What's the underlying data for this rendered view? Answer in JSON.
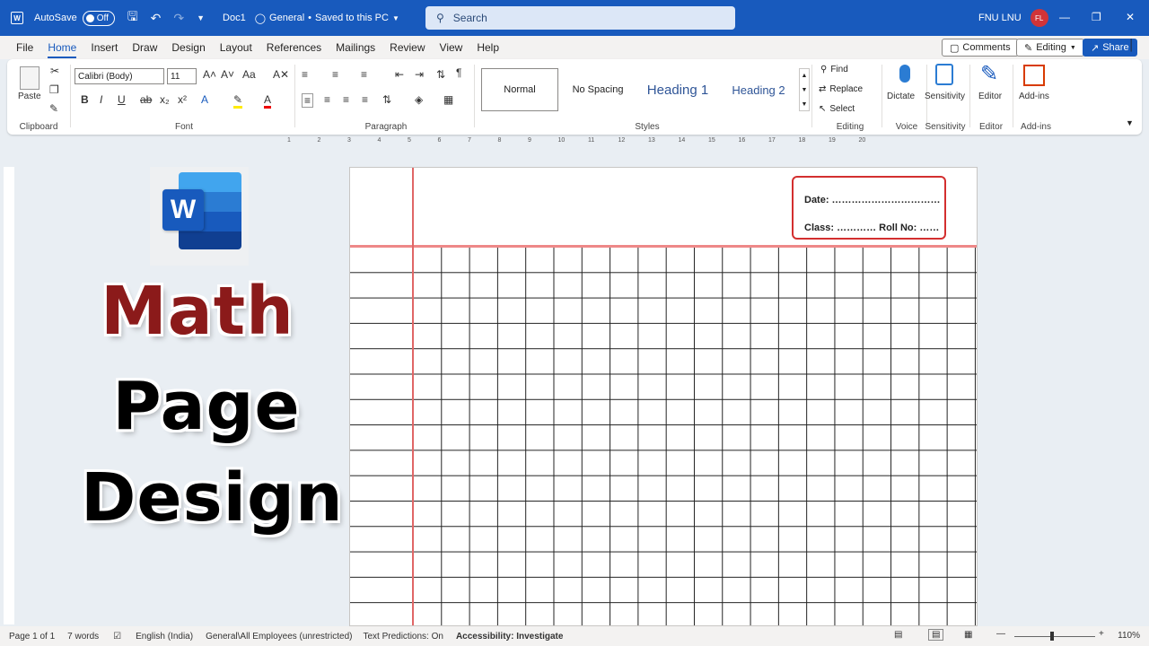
{
  "titlebar": {
    "autosave_label": "AutoSave",
    "toggle_state": "Off",
    "doc_name": "Doc1",
    "sensitivity": "General",
    "save_status": "Saved to this PC",
    "search_placeholder": "Search",
    "user_name": "FNU LNU",
    "user_initials": "FL"
  },
  "menu": {
    "tabs": [
      "File",
      "Home",
      "Insert",
      "Draw",
      "Design",
      "Layout",
      "References",
      "Mailings",
      "Review",
      "View",
      "Help"
    ],
    "active_tab": "Home",
    "comments_label": "Comments",
    "editing_label": "Editing",
    "share_label": "Share"
  },
  "ribbon": {
    "clipboard": {
      "paste_label": "Paste",
      "group_label": "Clipboard"
    },
    "font": {
      "font_name": "Calibri (Body)",
      "font_size": "11",
      "group_label": "Font"
    },
    "paragraph": {
      "group_label": "Paragraph"
    },
    "styles": {
      "items": [
        "Normal",
        "No Spacing",
        "Heading 1",
        "Heading 2"
      ],
      "group_label": "Styles"
    },
    "editing": {
      "find_label": "Find",
      "replace_label": "Replace",
      "select_label": "Select",
      "group_label": "Editing"
    },
    "voice": {
      "dictate_label": "Dictate",
      "group_label": "Voice"
    },
    "sensitivity": {
      "label": "Sensitivity",
      "group_label": "Sensitivity"
    },
    "editor": {
      "label": "Editor",
      "group_label": "Editor"
    },
    "addins": {
      "label": "Add-ins",
      "group_label": "Add-ins"
    }
  },
  "ruler": {
    "ticks": [
      "1",
      "2",
      "3",
      "4",
      "5",
      "6",
      "7",
      "8",
      "9",
      "10",
      "11",
      "12",
      "13",
      "14",
      "15",
      "16",
      "17",
      "18",
      "19",
      "20"
    ]
  },
  "overlay": {
    "title_line1": "Math",
    "title_line2": "Page",
    "title_line3": "Design",
    "logo_letter": "W"
  },
  "document": {
    "date_line": "Date: ……………………………",
    "class_line": "Class: ………… Roll No: ……"
  },
  "status": {
    "page": "Page 1 of 1",
    "words": "7 words",
    "language": "English (India)",
    "sensitivity": "General\\All Employees (unrestricted)",
    "predictions": "Text Predictions: On",
    "accessibility": "Accessibility: Investigate",
    "zoom": "110%"
  },
  "colors": {
    "brand": "#185abd",
    "math_title": "#8b1a1a",
    "margin_line": "#e06666",
    "infobox_border": "#d32f2f"
  }
}
